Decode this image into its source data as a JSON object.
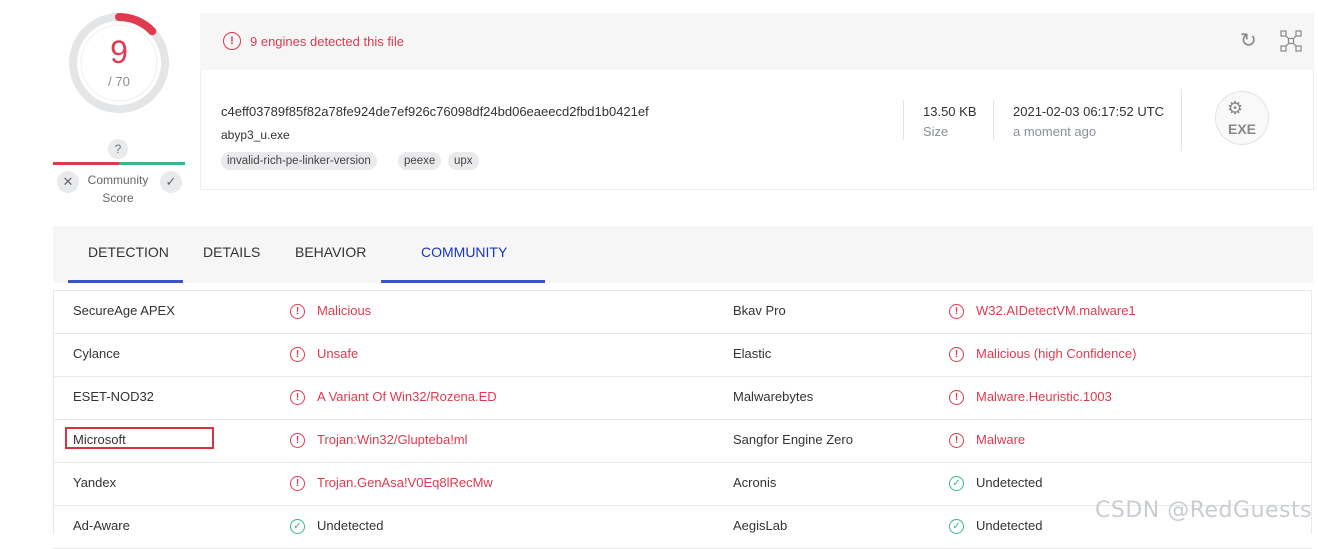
{
  "score": {
    "detected": "9",
    "total": "/ 70",
    "fraction": 0.1286,
    "accent": "#e03a4f"
  },
  "community": {
    "unknown_icon": "?",
    "label": "Community Score",
    "vote_down_icon": "close-icon",
    "vote_up_icon": "check-icon",
    "colors": {
      "negative": "#e03a4f",
      "positive": "#3db58a"
    }
  },
  "banner": {
    "text": "9 engines detected this file",
    "icon": "alert-icon",
    "actions": [
      "reload-icon",
      "graph-icon"
    ]
  },
  "file": {
    "hash": "c4eff03789f85f82a78fe924de7ef926c76098df24bd06eaeecd2fbd1b0421ef",
    "name": "abyp3_u.exe",
    "tags": [
      "invalid-rich-pe-linker-version",
      "peexe",
      "upx"
    ],
    "size_value": "13.50 KB",
    "size_label": "Size",
    "date_value": "2021-02-03 06:17:52 UTC",
    "date_label": "a moment ago",
    "type_badge": "EXE"
  },
  "tabs": [
    {
      "label": "DETECTION",
      "active": false,
      "underline_color": "#3a53c8"
    },
    {
      "label": "DETAILS",
      "active": false
    },
    {
      "label": "BEHAVIOR",
      "active": false
    },
    {
      "label": "COMMUNITY",
      "active": true,
      "color": "#1b35c4"
    }
  ],
  "detections": [
    {
      "engine_left": "SecureAge APEX",
      "result_left": "Malicious",
      "status_left": "malicious",
      "engine_right": "Bkav Pro",
      "result_right": "W32.AIDetectVM.malware1",
      "status_right": "malicious"
    },
    {
      "engine_left": "Cylance",
      "result_left": "Unsafe",
      "status_left": "malicious",
      "engine_right": "Elastic",
      "result_right": "Malicious (high Confidence)",
      "status_right": "malicious"
    },
    {
      "engine_left": "ESET-NOD32",
      "result_left": "A Variant Of Win32/Rozena.ED",
      "status_left": "malicious",
      "engine_right": "Malwarebytes",
      "result_right": "Malware.Heuristic.1003",
      "status_right": "malicious"
    },
    {
      "engine_left": "Microsoft",
      "result_left": "Trojan:Win32/Glupteba!ml",
      "status_left": "malicious",
      "engine_right": "Sangfor Engine Zero",
      "result_right": "Malware",
      "status_right": "malicious"
    },
    {
      "engine_left": "Yandex",
      "result_left": "Trojan.GenAsa!V0Eq8lRecMw",
      "status_left": "malicious",
      "engine_right": "Acronis",
      "result_right": "Undetected",
      "status_right": "undetected"
    },
    {
      "engine_left": "Ad-Aware",
      "result_left": "Undetected",
      "status_left": "undetected",
      "engine_right": "AegisLab",
      "result_right": "Undetected",
      "status_right": "undetected"
    }
  ],
  "watermark": "CSDN @RedGuests"
}
